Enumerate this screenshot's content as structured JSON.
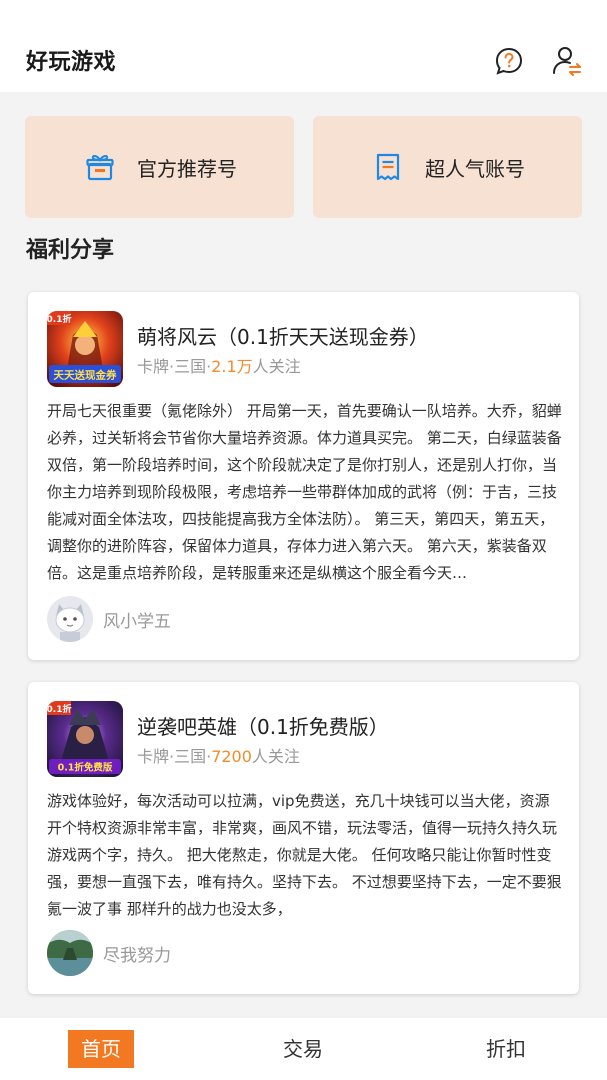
{
  "header": {
    "title": "好玩游戏",
    "help_icon": "question-bubble-icon",
    "user_icon": "user-swap-icon"
  },
  "quick_links": [
    {
      "label": "官方推荐号",
      "icon": "gift-icon"
    },
    {
      "label": "超人气账号",
      "icon": "receipt-icon"
    }
  ],
  "section": {
    "title": "福利分享"
  },
  "posts": [
    {
      "game_name": "萌将风云（0.1折天天送现金券）",
      "meta_prefix": "卡牌·三国·",
      "followers": "2.1万",
      "meta_suffix": "人关注",
      "description": "开局七天很重要（氪佬除外） 开局第一天，首先要确认一队培养。大乔，貂蝉必养，过关斩将会节省你大量培养资源。体力道具买完。 第二天，白绿蓝装备双倍，第一阶段培养时间，这个阶段就决定了是你打别人，还是别人打你，当你主力培养到现阶段极限，考虑培养一些带群体加成的武将（例：于吉，三技能减对面全体法攻，四技能提高我方全体法防）。 第三天，第四天，第五天，调整你的进阶阵容，保留体力道具，存体力进入第六天。 第六天，紫装备双倍。这是重点培养阶段，是转服重来还是纵横这个服全看今天…",
      "author": "风小学五",
      "icon_badge": "0.1折",
      "icon_banner": "天天送现金券"
    },
    {
      "game_name": "逆袭吧英雄（0.1折免费版）",
      "meta_prefix": "卡牌·三国·",
      "followers": "7200",
      "meta_suffix": "人关注",
      "description": "游戏体验好，每次活动可以拉满，vip免费送，充几十块钱可以当大佬，资源开个特权资源非常丰富，非常爽，画风不错，玩法零活，值得一玩持久持久玩游戏两个字，持久。 把大佬熬走，你就是大佬。 任何攻略只能让你暂时性变强，要想一直强下去，唯有持久。坚持下去。 不过想要坚持下去，一定不要狠氪一波了事 那样升的战力也没太多，",
      "author": "尽我努力",
      "icon_badge": "0.1折",
      "icon_banner": "0.1折免费版"
    }
  ],
  "tabs": {
    "home": "首页",
    "trade": "交易",
    "discount": "折扣"
  },
  "colors": {
    "accent": "#f27821",
    "highlight": "#f08c2e",
    "card_tint": "#f7e1d3",
    "icon_blue": "#1e88e5"
  }
}
